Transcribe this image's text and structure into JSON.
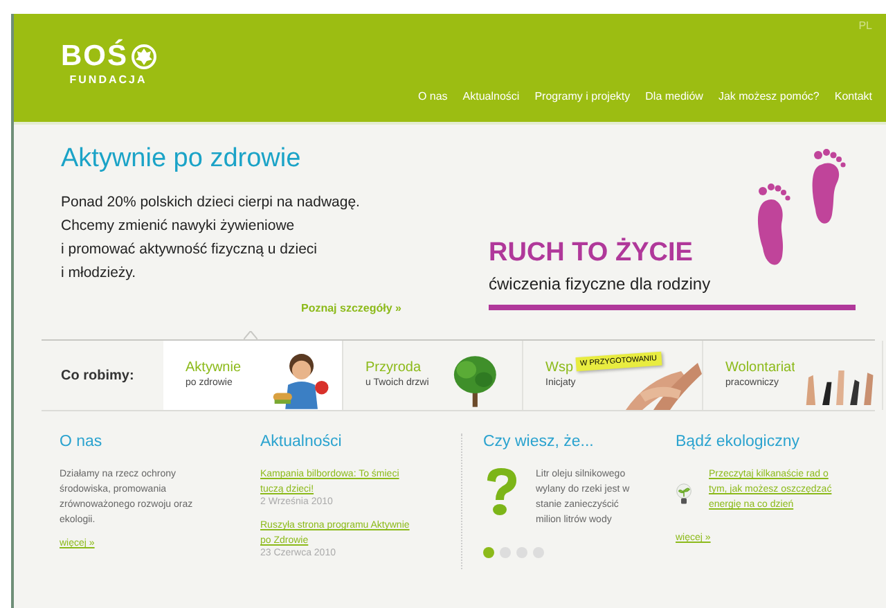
{
  "header": {
    "logo": {
      "name": "BOŚ",
      "subtitle": "FUNDACJA"
    },
    "language": "PL",
    "nav": [
      {
        "label": "O nas"
      },
      {
        "label": "Aktualności"
      },
      {
        "label": "Programy i projekty"
      },
      {
        "label": "Dla mediów"
      },
      {
        "label": "Jak możesz pomóc?"
      },
      {
        "label": "Kontakt"
      }
    ]
  },
  "hero": {
    "title": "Aktywnie po zdrowie",
    "lines": [
      "Ponad 20% polskich dzieci cierpi na nadwagę.",
      "Chcemy zmienić nawyki żywieniowe",
      "i promować aktywność fizyczną u dzieci",
      "i młodzieży."
    ],
    "link": "Poznaj szczegóły »",
    "banner": {
      "title": "RUCH TO ŻYCIE",
      "subtitle": "ćwiczenia fizyczne dla rodziny"
    }
  },
  "what_we_do": {
    "label": "Co robimy:",
    "tabs": [
      {
        "title": "Aktywnie",
        "subtitle": "po zdrowie",
        "selected": true,
        "kind": "child"
      },
      {
        "title": "Przyroda",
        "subtitle": "u Twoich drzwi",
        "selected": false,
        "kind": "tree"
      },
      {
        "title": "Wsp",
        "subtitle": "Inicjaty",
        "selected": false,
        "kind": "hands",
        "badge": "W PRZYGOTOWANIU"
      },
      {
        "title": "Wolontariat",
        "subtitle": "pracowniczy",
        "selected": false,
        "kind": "crowd"
      }
    ]
  },
  "columns": [
    {
      "kind": "text",
      "title": "O nas",
      "text": "Działamy na rzecz ochrony środowiska, promowania zrównoważonego rozwoju oraz ekologii.",
      "more": "więcej »"
    },
    {
      "kind": "news",
      "title": "Aktualności",
      "items": [
        {
          "link": "Kampania bilbordowa: To śmieci tuczą dzieci!",
          "date": "2 Września 2010"
        },
        {
          "link": "Ruszyła strona programu Aktywnie po Zdrowie",
          "date": "23 Czerwca 2010"
        }
      ]
    },
    {
      "kind": "fact",
      "title": "Czy wiesz, że...",
      "text": "Litr oleju silnikowego wylany do rzeki jest w stanie zanieczyścić milion litrów wody",
      "dots": [
        {
          "selected": true
        },
        {
          "selected": false
        },
        {
          "selected": false
        },
        {
          "selected": false
        }
      ]
    },
    {
      "kind": "eco",
      "title": "Bądź ekologiczny",
      "link": "Przeczytaj kilkanaście rad o tym, jak możesz oszczędzać energię na co dzień",
      "more": "więcej »"
    }
  ]
}
